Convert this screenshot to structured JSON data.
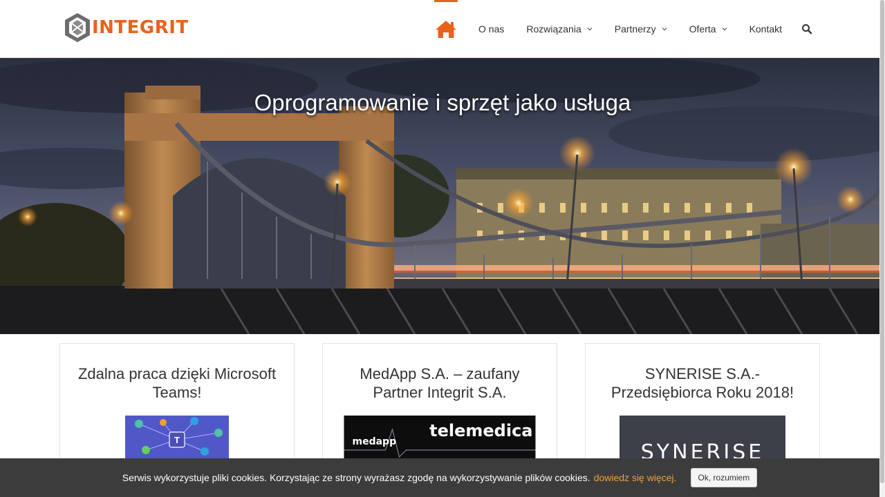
{
  "header": {
    "logo_text": "INTEGRIT",
    "nav": [
      {
        "label": "O nas",
        "has_dropdown": false
      },
      {
        "label": "Rozwiązania",
        "has_dropdown": true
      },
      {
        "label": "Partnerzy",
        "has_dropdown": true
      },
      {
        "label": "Oferta",
        "has_dropdown": true
      },
      {
        "label": "Kontakt",
        "has_dropdown": false
      }
    ],
    "icons": [
      "home-icon",
      "search-icon",
      "chevron-down-icon"
    ]
  },
  "hero": {
    "title": "Oprogramowanie i sprzęt jako usługa"
  },
  "cards": [
    {
      "title": "Zdalna praca dzięki Microsoft Teams!"
    },
    {
      "title": "MedApp S.A. – zaufany Partner Integrit S.A.",
      "image_text_left": "medapp",
      "image_text_right": "telemedica"
    },
    {
      "title": "SYNERISE S.A.- Przedsiębiorca Roku 2018!",
      "image_text": "SYNERISE"
    }
  ],
  "cookie": {
    "text": "Serwis wykorzystuje pliki cookies. Korzystając ze strony wyrażasz zgodę na wykorzystywanie plików cookies.",
    "link": "dowiedz się więcej.",
    "button": "Ok, rozumiem"
  },
  "colors": {
    "accent": "#e8621c",
    "cookie_bg": "#3c3c3c",
    "cookie_link": "#e8a33c"
  }
}
